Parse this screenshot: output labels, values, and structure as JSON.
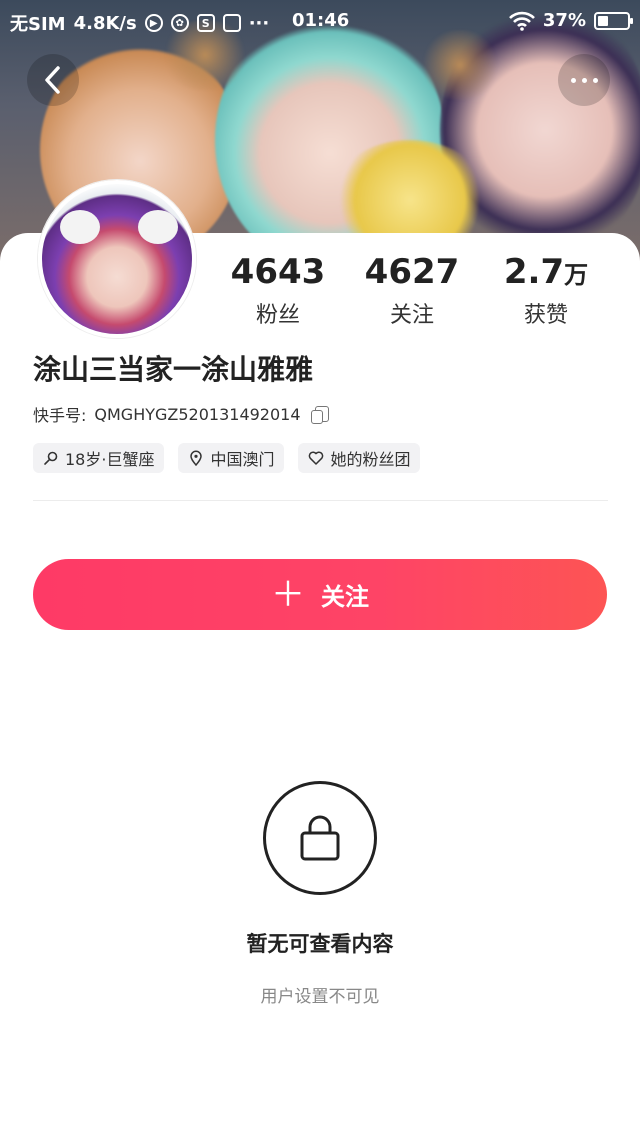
{
  "status_bar": {
    "carrier": "无SIM",
    "speed": "4.8K/s",
    "time": "01:46",
    "battery": "37%",
    "battery_level": 0.37,
    "overflow": "···"
  },
  "profile": {
    "stats": [
      {
        "value": "4643",
        "unit": "",
        "label": "粉丝"
      },
      {
        "value": "4627",
        "unit": "",
        "label": "关注"
      },
      {
        "value": "2.7",
        "unit": "万",
        "label": "获赞"
      }
    ],
    "name": "涂山三当家一涂山雅雅",
    "kuaishou_id_label": "快手号:",
    "kuaishou_id": "QMGHYGZ520131492014",
    "tags": [
      {
        "icon": "gender-icon",
        "label": "18岁·巨蟹座"
      },
      {
        "icon": "location-pin-icon",
        "label": "中国澳门"
      },
      {
        "icon": "heart-icon",
        "label": "她的粉丝团"
      }
    ]
  },
  "follow_button": {
    "icon": "plus-icon",
    "label": "关注"
  },
  "empty_state": {
    "icon": "lock-icon",
    "title": "暂无可查看内容",
    "subtitle": "用户设置不可见"
  },
  "colors": {
    "accent": "#fe3a66",
    "text": "#222222",
    "muted": "#888888"
  }
}
